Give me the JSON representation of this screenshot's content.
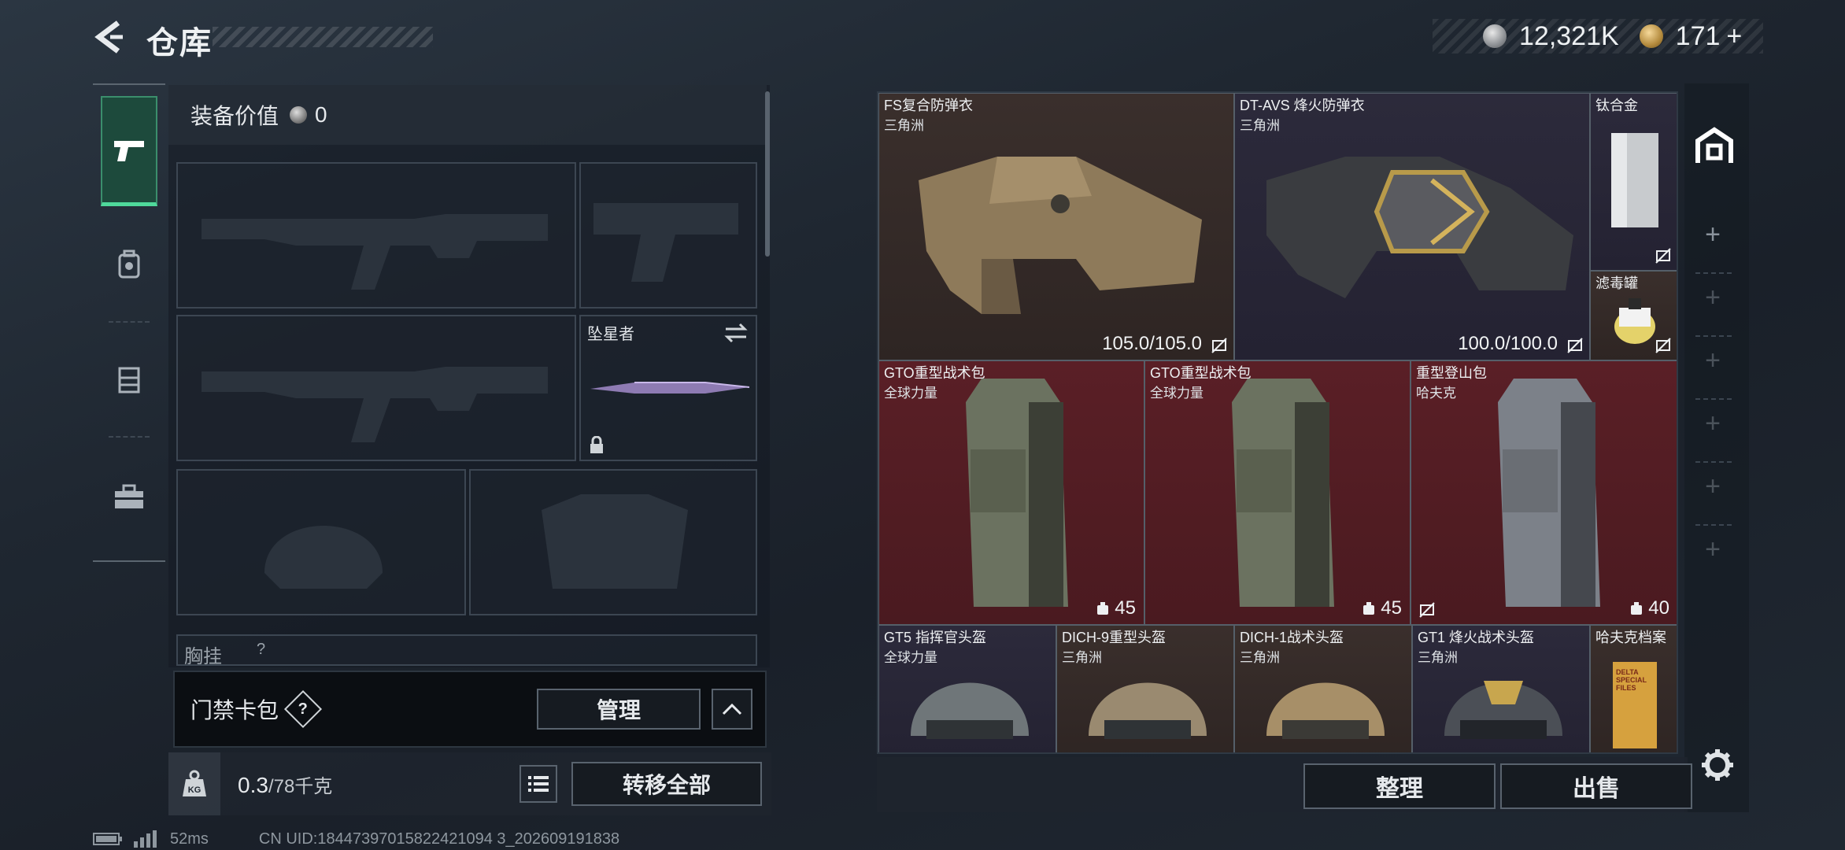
{
  "header": {
    "title": "仓库"
  },
  "currency": {
    "silver": "12,321K",
    "gold": "171",
    "add_symbol": "+"
  },
  "equipment": {
    "value_label": "装备价值",
    "value": "0",
    "melee_slot_name": "坠星者",
    "chest_rig_label": "胸挂",
    "chest_rig_help": "?"
  },
  "keycard": {
    "label": "门禁卡包",
    "help": "?",
    "manage_label": "管理"
  },
  "weight": {
    "current": "0.3",
    "capacity": "/78千克"
  },
  "transfer_all_label": "转移全部",
  "storage_items": [
    {
      "name": "FS复合防弹衣",
      "sub": "三角洲",
      "durability": "105.0/105.0"
    },
    {
      "name": "DT-AVS 烽火防弹衣",
      "sub": "三角洲",
      "durability": "100.0/100.0"
    },
    {
      "name": "钛合金",
      "sub": ""
    },
    {
      "name": "滤毒罐",
      "sub": ""
    },
    {
      "name": "GTO重型战术包",
      "sub": "全球力量",
      "capacity": "45"
    },
    {
      "name": "GTO重型战术包",
      "sub": "全球力量",
      "capacity": "45"
    },
    {
      "name": "重型登山包",
      "sub": "哈夫克",
      "capacity": "40"
    },
    {
      "name": "GT5 指挥官头盔",
      "sub": "全球力量"
    },
    {
      "name": "DICH-9重型头盔",
      "sub": "三角洲"
    },
    {
      "name": "DICH-1战术头盔",
      "sub": "三角洲"
    },
    {
      "name": "GT1 烽火战术头盔",
      "sub": "三角洲"
    },
    {
      "name": "哈夫克档案",
      "sub": ""
    }
  ],
  "archive_cover_text": "DELTA SPECIAL FILES",
  "storage_actions": {
    "sort_label": "整理",
    "sell_label": "出售"
  },
  "status": {
    "ping": "52ms",
    "uid": "CN UID:18447397015822421094 3_202609191838"
  },
  "colors": {
    "accent_green": "#4fd99b",
    "brown_cell": "#3a2f2c",
    "purple_cell": "#2c2a3b",
    "red_cell": "#5a1f26"
  },
  "icons": [
    "back-arrow-icon",
    "silver-coin-icon",
    "gold-coin-icon",
    "pistol-icon",
    "backpack-icon",
    "rig-icon",
    "toolbox-icon",
    "swap-icon",
    "lock-icon",
    "weight-icon",
    "list-icon",
    "chevron-up-icon",
    "storage-icon",
    "plus-icon",
    "gear-icon",
    "battery-icon",
    "signal-icon",
    "no-insurance-icon",
    "capacity-icon"
  ]
}
